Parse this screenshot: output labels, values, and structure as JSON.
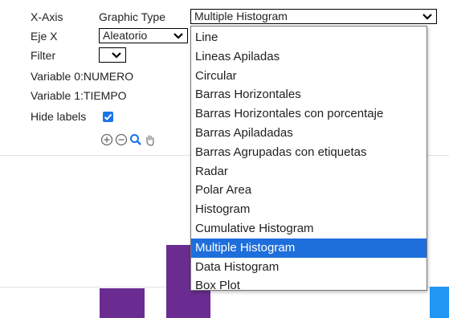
{
  "controls": {
    "x_axis_label": "X-Axis",
    "graphic_type_label": "Graphic Type",
    "graphic_type_value": "Multiple Histogram",
    "eje_x_label": "Eje X",
    "eje_x_value": "Aleatorio",
    "filter_label": "Filter",
    "filter_value": "",
    "variable0_label": "Variable 0:",
    "variable0_value": "NUMERO",
    "variable1_label": "Variable 1:",
    "variable1_value": "TIEMPO",
    "hide_labels_label": "Hide labels",
    "hide_labels_checked": true
  },
  "dropdown": {
    "options": [
      "Line",
      "Lineas Apiladas",
      "Circular",
      "Barras Horizontales",
      "Barras Horizontales con porcentaje",
      "Barras Apiladadas",
      "Barras Agrupadas con etiquetas",
      "Radar",
      "Polar Area",
      "Histogram",
      "Cumulative Histogram",
      "Multiple Histogram",
      "Data Histogram",
      "Box Plot"
    ],
    "selected_index": 11
  },
  "toolbar": {
    "icons": [
      "zoom-in-icon",
      "zoom-out-icon",
      "magnify-icon",
      "pan-hand-icon"
    ]
  },
  "colors": {
    "selection": "#1e6fdc",
    "bar_purple": "#6a2c91",
    "bar_blue": "#2196f3",
    "checkbox": "#1a73e8"
  }
}
